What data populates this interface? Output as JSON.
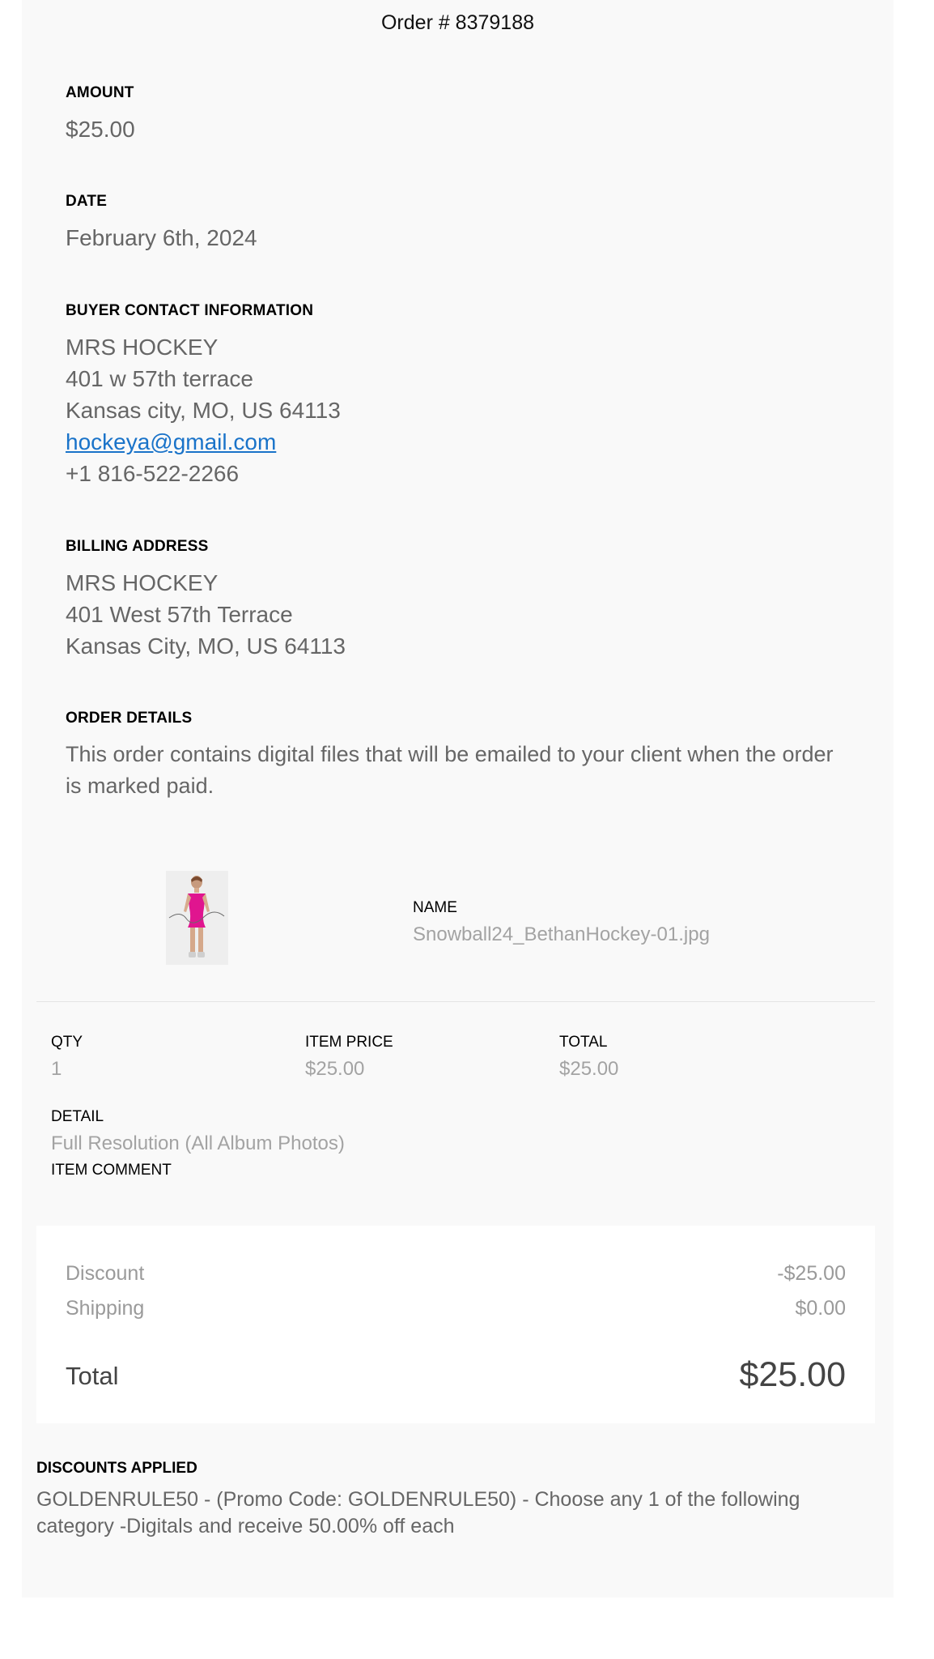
{
  "order": {
    "title": "Order # 8379188"
  },
  "amount": {
    "label": "AMOUNT",
    "value": "$25.00"
  },
  "date": {
    "label": "DATE",
    "value": "February 6th, 2024"
  },
  "buyer": {
    "label": "BUYER CONTACT INFORMATION",
    "name": "MRS HOCKEY",
    "street": "401 w 57th terrace",
    "city": "Kansas city, MO, US 64113",
    "email": "hockeya@gmail.com",
    "phone": "+1 816-522-2266"
  },
  "billing": {
    "label": "BILLING ADDRESS",
    "name": "MRS HOCKEY",
    "street": "401 West 57th Terrace",
    "city": "Kansas City, MO, US 64113"
  },
  "order_details": {
    "label": "ORDER DETAILS",
    "text": "This order contains digital files that will be emailed to your client when the order is marked paid."
  },
  "item": {
    "name_label": "NAME",
    "name": "Snowball24_BethanHockey-01.jpg",
    "qty_label": "QTY",
    "qty": "1",
    "price_label": "ITEM PRICE",
    "price": "$25.00",
    "total_label": "TOTAL",
    "total": "$25.00",
    "detail_label": "DETAIL",
    "detail": "Full Resolution (All Album Photos)",
    "comment_label": "ITEM COMMENT"
  },
  "summary": {
    "discount_label": "Discount",
    "discount": "-$25.00",
    "shipping_label": "Shipping",
    "shipping": "$0.00",
    "total_label": "Total",
    "total": "$25.00"
  },
  "discounts_applied": {
    "label": "DISCOUNTS APPLIED",
    "text": "GOLDENRULE50 - (Promo Code: GOLDENRULE50) - Choose any 1 of the following category -Digitals and receive 50.00% off each"
  }
}
